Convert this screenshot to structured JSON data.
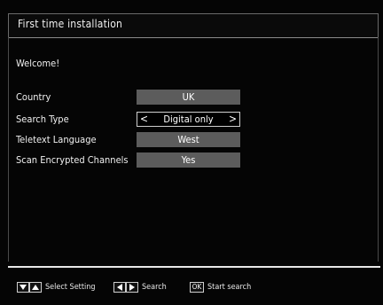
{
  "header": {
    "title": "First time installation"
  },
  "main": {
    "welcome": "Welcome!",
    "rows": [
      {
        "label": "Country",
        "value": "UK"
      },
      {
        "label": "Search Type",
        "value": "Digital only",
        "left_arrow": "<",
        "right_arrow": ">"
      },
      {
        "label": "Teletext Language",
        "value": "West"
      },
      {
        "label": "Scan Encrypted Channels",
        "value": "Yes"
      }
    ]
  },
  "footer": {
    "hint_select": "Select Setting",
    "hint_search": "Search",
    "hint_ok_key": "OK",
    "hint_start": "Start search"
  },
  "colors": {
    "background": "#000000",
    "value_box": "#5c5c5c",
    "text": "#ffffff"
  }
}
